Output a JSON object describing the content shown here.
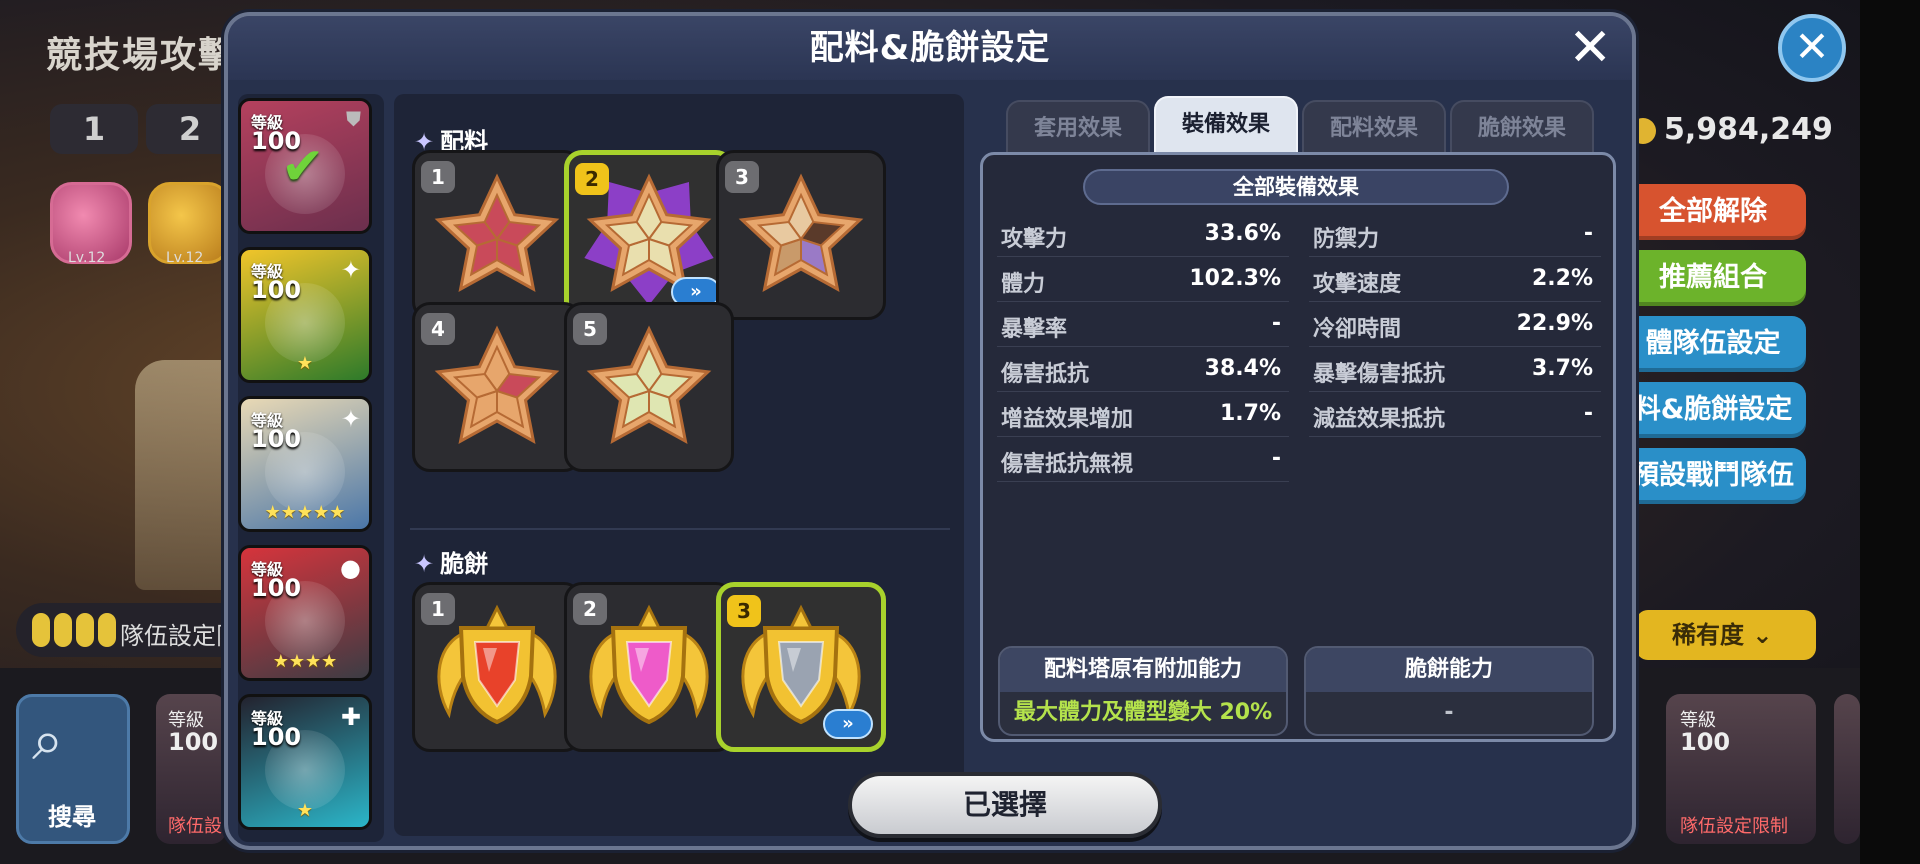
{
  "background": {
    "title": "競技場攻擊",
    "tabs": [
      "1",
      "2"
    ],
    "chest_levels": [
      "Lv.12",
      "Lv.12"
    ],
    "team_limit_text": "隊伍設定限",
    "coins": "5,984,249",
    "side_buttons": [
      "全部解除",
      "推薦組合",
      "體隊伍設定",
      "料&脆餅設定",
      "預設戰鬥隊伍"
    ],
    "rarity_label": "稀有度",
    "search_label": "搜尋",
    "bottom_cards": [
      {
        "lv_label": "等級",
        "lv": "100",
        "tag": "隊伍設"
      },
      {
        "lv_label": "等級",
        "lv": "100",
        "tag": "隊伍設定限制"
      }
    ]
  },
  "dialog": {
    "title": "配料&脆餅設定",
    "cookies": [
      {
        "level_label": "等級",
        "level": "100",
        "stars": "",
        "selected": true,
        "colors": [
          "#b5415e",
          "#6b2f4d"
        ]
      },
      {
        "level_label": "等級",
        "level": "100",
        "stars": "★",
        "selected": false,
        "colors": [
          "#f1c52a",
          "#2d7a2a"
        ]
      },
      {
        "level_label": "等級",
        "level": "100",
        "stars": "★★★★★",
        "selected": false,
        "colors": [
          "#e9d9b5",
          "#4a76a8"
        ]
      },
      {
        "level_label": "等級",
        "level": "100",
        "stars": "★★★★",
        "selected": false,
        "colors": [
          "#d6343c",
          "#3c3c44"
        ]
      },
      {
        "level_label": "等級",
        "level": "100",
        "stars": "★",
        "selected": false,
        "colors": [
          "#23222e",
          "#2bb6c9"
        ]
      }
    ],
    "toppings_header": "配料",
    "toppings": [
      {
        "slot": "1",
        "selected": false,
        "variant": "raspberry"
      },
      {
        "slot": "2",
        "selected": true,
        "variant": "almond-amethyst"
      },
      {
        "slot": "3",
        "selected": false,
        "variant": "mixed"
      },
      {
        "slot": "4",
        "selected": false,
        "variant": "partial"
      },
      {
        "slot": "5",
        "selected": false,
        "variant": "almond"
      }
    ],
    "biscuits_header": "脆餅",
    "biscuits": [
      {
        "slot": "1",
        "selected": false,
        "gem": "#e8422a"
      },
      {
        "slot": "2",
        "selected": false,
        "gem": "#ee5bc9"
      },
      {
        "slot": "3",
        "selected": true,
        "gem": "#9aa3b1"
      }
    ],
    "tabs": [
      "套用效果",
      "裝備效果",
      "配料效果",
      "脆餅效果"
    ],
    "active_tab": 1,
    "effects_header": "全部裝備效果",
    "effects_left": [
      {
        "label": "攻擊力",
        "value": "33.6%"
      },
      {
        "label": "體力",
        "value": "102.3%"
      },
      {
        "label": "暴擊率",
        "value": "-"
      },
      {
        "label": "傷害抵抗",
        "value": "38.4%"
      },
      {
        "label": "增益效果增加",
        "value": "1.7%"
      },
      {
        "label": "傷害抵抗無視",
        "value": "-"
      }
    ],
    "effects_right": [
      {
        "label": "防禦力",
        "value": "-"
      },
      {
        "label": "攻擊速度",
        "value": "2.2%"
      },
      {
        "label": "冷卻時間",
        "value": "22.9%"
      },
      {
        "label": "暴擊傷害抵抗",
        "value": "3.7%"
      },
      {
        "label": "減益效果抵抗",
        "value": "-"
      }
    ],
    "tower_bonus_title": "配料塔原有附加能力",
    "tower_bonus_value": "最大體力及體型變大 20%",
    "biscuit_ability_title": "脆餅能力",
    "biscuit_ability_value": "-",
    "selected_button": "已選擇",
    "arrow_glyph": "»",
    "colors": {
      "accent_green": "#a8d22c",
      "dialog_bg": "#27314c",
      "gold": "#f0c31a"
    }
  }
}
